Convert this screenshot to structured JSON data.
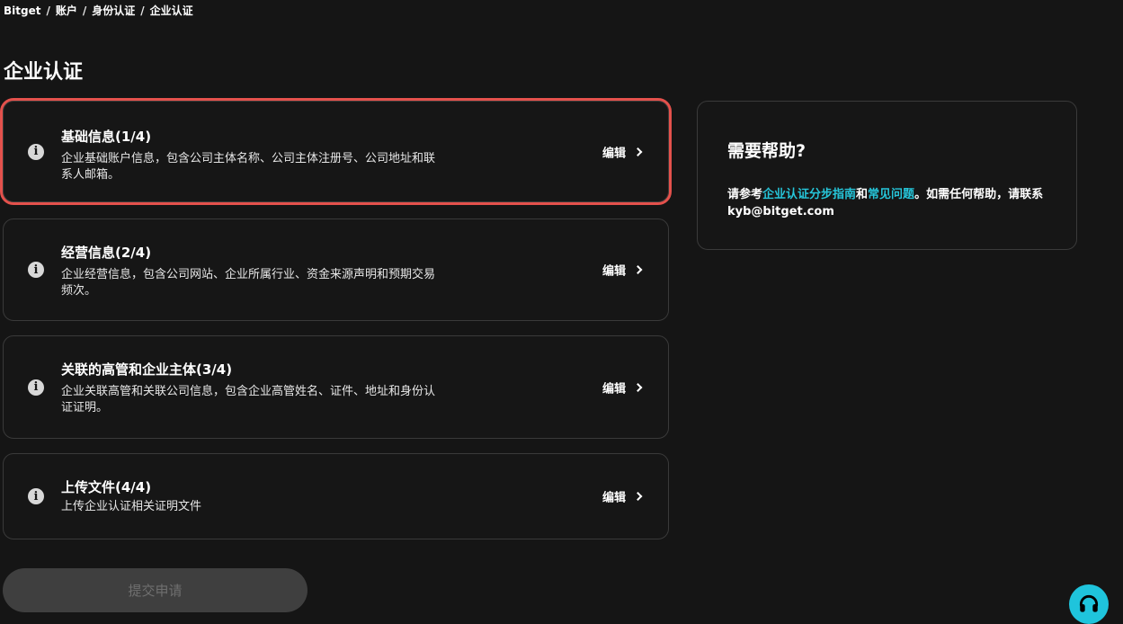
{
  "breadcrumb": {
    "items": [
      "Bitget",
      "账户",
      "身份认证",
      "企业认证"
    ],
    "separator": "/"
  },
  "page": {
    "title": "企业认证"
  },
  "steps": [
    {
      "title": "基础信息(1/4)",
      "desc": "企业基础账户信息，包含公司主体名称、公司主体注册号、公司地址和联系人邮箱。",
      "edit": "编辑",
      "selected": true
    },
    {
      "title": "经营信息(2/4)",
      "desc": "企业经营信息，包含公司网站、企业所属行业、资金来源声明和预期交易频次。",
      "edit": "编辑"
    },
    {
      "title": "关联的高管和企业主体(3/4)",
      "desc": "企业关联高管和关联公司信息，包含企业高管姓名、证件、地址和身份认证证明。",
      "edit": "编辑"
    },
    {
      "title": "上传文件(4/4)",
      "desc": "上传企业认证相关证明文件",
      "edit": "编辑"
    }
  ],
  "help": {
    "title": "需要帮助?",
    "body_prefix": "请参考",
    "link_guide": "企业认证分步指南",
    "body_and": "和",
    "link_faq": "常见问题",
    "body_suffix": "。如需任何帮助，请联系 kyb@bitget.com"
  },
  "submit": {
    "label": "提交申请"
  },
  "colors": {
    "background": "#151515",
    "accent": "#1fc4dc",
    "link": "#26c6da",
    "selection_outline": "#e4514c"
  },
  "icons": {
    "info": "info-icon",
    "chevron": "chevron-right-icon",
    "support": "headset-icon"
  }
}
